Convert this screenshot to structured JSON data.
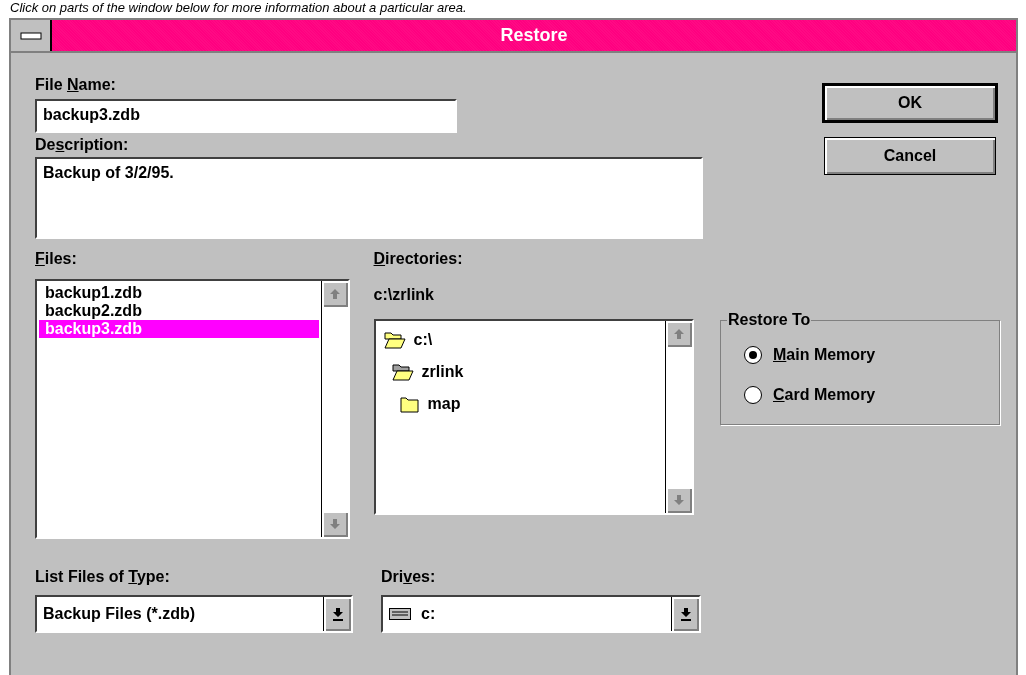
{
  "caption": "Click on parts of the window below for more information about a particular area.",
  "window": {
    "title": "Restore"
  },
  "file_name": {
    "label": {
      "before": "File ",
      "key": "N",
      "after": "ame:"
    },
    "value": "backup3.zdb"
  },
  "description": {
    "label": {
      "before": "De",
      "key": "s",
      "after": "cription:"
    },
    "value": "Backup of 3/2/95."
  },
  "buttons": [
    {
      "label": "OK",
      "default": true
    },
    {
      "label": "Cancel",
      "default": false
    }
  ],
  "files": {
    "label": {
      "key": "F",
      "after": "iles:"
    },
    "items": [
      {
        "name": "backup1.zdb",
        "selected": false
      },
      {
        "name": "backup2.zdb",
        "selected": false
      },
      {
        "name": "backup3.zdb",
        "selected": true
      }
    ]
  },
  "directories": {
    "label": {
      "key": "D",
      "after": "irectories:"
    },
    "path": "c:\\zrlink",
    "items": [
      {
        "name": "c:\\",
        "kind": "open",
        "children": [
          {
            "name": "zrlink",
            "kind": "current",
            "children": [
              {
                "name": "map",
                "kind": "closed"
              }
            ]
          }
        ]
      }
    ]
  },
  "restore_to": {
    "title": "Restore To",
    "options": [
      {
        "label": {
          "key": "M",
          "after": "ain Memory"
        },
        "selected": true
      },
      {
        "label": {
          "key": "C",
          "after": "ard Memory"
        },
        "selected": false
      }
    ]
  },
  "file_type": {
    "label": {
      "before": "List Files of ",
      "key": "T",
      "after": "ype:"
    },
    "value": "Backup Files (*.zdb)"
  },
  "drives": {
    "label": {
      "before": "Dri",
      "key": "v",
      "after": "es:"
    },
    "value": "c:"
  }
}
